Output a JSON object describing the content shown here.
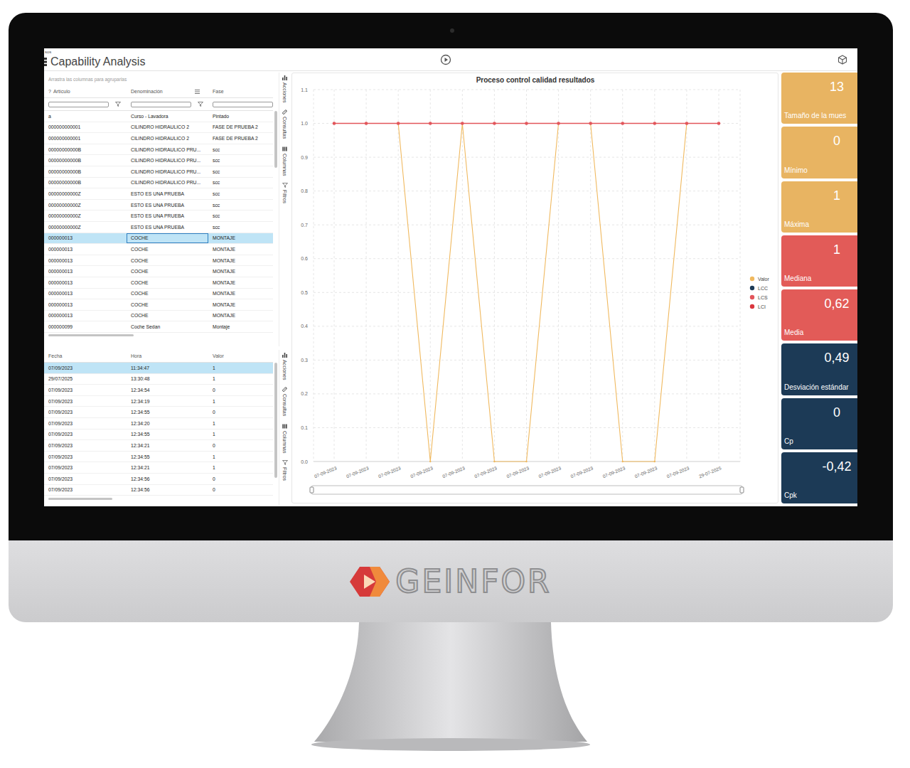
{
  "app": {
    "top_label": "sos",
    "title": "Capability Analysis"
  },
  "articles_grid": {
    "hint": "Arrastra las columnas para agruparlas",
    "columns": [
      {
        "label": "Artículo",
        "glyph": "?"
      },
      {
        "label": "Denominación"
      },
      {
        "label": "Fase"
      }
    ],
    "rows": [
      {
        "cells": [
          "a",
          "Curso - Lavadora",
          "Pintado"
        ],
        "selected": false,
        "focused": false
      },
      {
        "cells": [
          "000000000001",
          "CILINDRO HIDRAULICO 2",
          "FASE DE PRUEBA 2"
        ],
        "selected": false,
        "focused": false
      },
      {
        "cells": [
          "000000000001",
          "CILINDRO HIDRAULICO 2",
          "FASE DE PRUEBA 2"
        ],
        "selected": false,
        "focused": false
      },
      {
        "cells": [
          "00000000000B",
          "CILINDRO HIDRAULICO PRU...",
          "scc"
        ],
        "selected": false,
        "focused": false
      },
      {
        "cells": [
          "00000000000B",
          "CILINDRO HIDRAULICO PRU...",
          "scc"
        ],
        "selected": false,
        "focused": false
      },
      {
        "cells": [
          "00000000000B",
          "CILINDRO HIDRAULICO PRU...",
          "scc"
        ],
        "selected": false,
        "focused": false
      },
      {
        "cells": [
          "00000000000B",
          "CILINDRO HIDRAULICO PRU...",
          "scc"
        ],
        "selected": false,
        "focused": false
      },
      {
        "cells": [
          "00000000000Z",
          "ESTO ES UNA PRUEBA",
          "scc"
        ],
        "selected": false,
        "focused": false
      },
      {
        "cells": [
          "00000000000Z",
          "ESTO ES UNA PRUEBA",
          "scc"
        ],
        "selected": false,
        "focused": false
      },
      {
        "cells": [
          "00000000000Z",
          "ESTO ES UNA PRUEBA",
          "scc"
        ],
        "selected": false,
        "focused": false
      },
      {
        "cells": [
          "00000000000Z",
          "ESTO ES UNA PRUEBA",
          "scc"
        ],
        "selected": false,
        "focused": false
      },
      {
        "cells": [
          "000000013",
          "COCHE",
          "MONTAJE"
        ],
        "selected": true,
        "focused": true
      },
      {
        "cells": [
          "000000013",
          "COCHE",
          "MONTAJE"
        ],
        "selected": false,
        "focused": false
      },
      {
        "cells": [
          "000000013",
          "COCHE",
          "MONTAJE"
        ],
        "selected": false,
        "focused": false
      },
      {
        "cells": [
          "000000013",
          "COCHE",
          "MONTAJE"
        ],
        "selected": false,
        "focused": false
      },
      {
        "cells": [
          "000000013",
          "COCHE",
          "MONTAJE"
        ],
        "selected": false,
        "focused": false
      },
      {
        "cells": [
          "000000013",
          "COCHE",
          "MONTAJE"
        ],
        "selected": false,
        "focused": false
      },
      {
        "cells": [
          "000000013",
          "COCHE",
          "MONTAJE"
        ],
        "selected": false,
        "focused": false
      },
      {
        "cells": [
          "000000013",
          "COCHE",
          "MONTAJE"
        ],
        "selected": false,
        "focused": false
      },
      {
        "cells": [
          "000000099",
          "Coche Sedan",
          "Montaje"
        ],
        "selected": false,
        "focused": false
      }
    ]
  },
  "side_tabs_upper": [
    "Acciones",
    "Consultas",
    "Columnas",
    "Filtros"
  ],
  "results_grid": {
    "columns": [
      "Fecha",
      "Hora",
      "Valor"
    ],
    "rows": [
      {
        "cells": [
          "07/09/2023",
          "11:34:47",
          "1"
        ],
        "selected": true
      },
      {
        "cells": [
          "29/07/2025",
          "13:30:48",
          "1"
        ],
        "selected": false
      },
      {
        "cells": [
          "07/09/2023",
          "12:34:54",
          "0"
        ],
        "selected": false
      },
      {
        "cells": [
          "07/09/2023",
          "12:34:19",
          "1"
        ],
        "selected": false
      },
      {
        "cells": [
          "07/09/2023",
          "12:34:55",
          "0"
        ],
        "selected": false
      },
      {
        "cells": [
          "07/09/2023",
          "12:34:20",
          "1"
        ],
        "selected": false
      },
      {
        "cells": [
          "07/09/2023",
          "12:34:55",
          "1"
        ],
        "selected": false
      },
      {
        "cells": [
          "07/09/2023",
          "12:34:21",
          "0"
        ],
        "selected": false
      },
      {
        "cells": [
          "07/09/2023",
          "12:34:55",
          "1"
        ],
        "selected": false
      },
      {
        "cells": [
          "07/09/2023",
          "12:34:21",
          "1"
        ],
        "selected": false
      },
      {
        "cells": [
          "07/09/2023",
          "12:34:56",
          "0"
        ],
        "selected": false
      },
      {
        "cells": [
          "07/09/2023",
          "12:34:56",
          "0"
        ],
        "selected": false
      }
    ]
  },
  "side_tabs_lower": [
    "Acciones",
    "Consultas",
    "Columnas",
    "Filtros"
  ],
  "chart": {
    "title": "Proceso control calidad resultados",
    "y_ticks": [
      "1.1",
      "1.0",
      "0.9",
      "0.8",
      "0.7",
      "0.6",
      "0.5",
      "0.4",
      "0.3",
      "0.2",
      "0.1",
      "0.0"
    ],
    "x_labels": [
      "07-09-2023",
      "07-09-2023",
      "07-09-2023",
      "07-09-2023",
      "07-09-2023",
      "07-09-2023",
      "07-09-2023",
      "07-09-2023",
      "07-09-2023",
      "07-09-2023",
      "07-09-2023",
      "07-09-2023",
      "29-07-2025"
    ],
    "series": [
      {
        "kind": "line",
        "color": "#f0b95f",
        "values": [
          1,
          1,
          1,
          0,
          1,
          0,
          0,
          1,
          1,
          0,
          0,
          1,
          1
        ]
      },
      {
        "kind": "line-markers",
        "color": "#e2555a",
        "values": [
          1,
          1,
          1,
          1,
          1,
          1,
          1,
          1,
          1,
          1,
          1,
          1,
          1
        ]
      }
    ],
    "legend": [
      {
        "label": "Valor",
        "color": "#f0b95f"
      },
      {
        "label": "LCC",
        "color": "#1c3a56"
      },
      {
        "label": "LCS",
        "color": "#e2555a"
      },
      {
        "label": "LCI",
        "color": "#d9363e"
      }
    ]
  },
  "stats": [
    {
      "value": "13",
      "label": "Tamaño de la mues",
      "color": "#e8b462"
    },
    {
      "value": "0",
      "label": "Mínimo",
      "color": "#e8b462"
    },
    {
      "value": "1",
      "label": "Máxima",
      "color": "#e8b462"
    },
    {
      "value": "1",
      "label": "Mediana",
      "color": "#e25b58"
    },
    {
      "value": "0,62",
      "label": "Media",
      "color": "#e25b58"
    },
    {
      "value": "0,49",
      "label": "Desviación estándar",
      "color": "#1c3a56"
    },
    {
      "value": "0",
      "label": "Cp",
      "color": "#1c3a56"
    },
    {
      "value": "-0,42",
      "label": "Cpk",
      "color": "#1c3a56"
    }
  ],
  "logo": {
    "text": "GEINFOR"
  }
}
